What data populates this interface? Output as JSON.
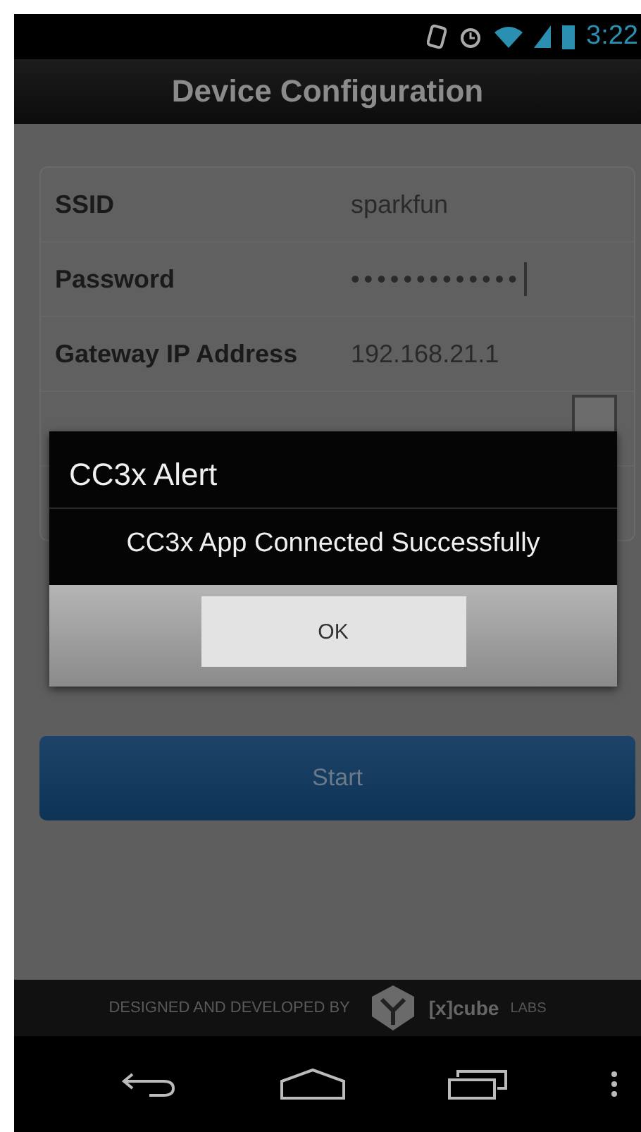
{
  "status_bar": {
    "time": "3:22"
  },
  "title_bar": {
    "title": "Device Configuration"
  },
  "form": {
    "fields": [
      {
        "kind": "text",
        "label": "SSID",
        "value": "sparkfun"
      },
      {
        "kind": "password",
        "label": "Password",
        "value": "•••••••••••••"
      },
      {
        "kind": "text",
        "label": "Gateway IP Address",
        "value": "192.168.21.1"
      },
      {
        "kind": "checkbox",
        "checked": false
      },
      {
        "kind": "blank"
      }
    ]
  },
  "start_button": {
    "label": "Start"
  },
  "dialog": {
    "title": "CC3x Alert",
    "message": "CC3x App Connected Successfully",
    "button": "OK"
  },
  "footer": {
    "credit": "DESIGNED AND DEVELOPED BY",
    "brand": "[x]cube",
    "brand_suffix": "LABS"
  }
}
